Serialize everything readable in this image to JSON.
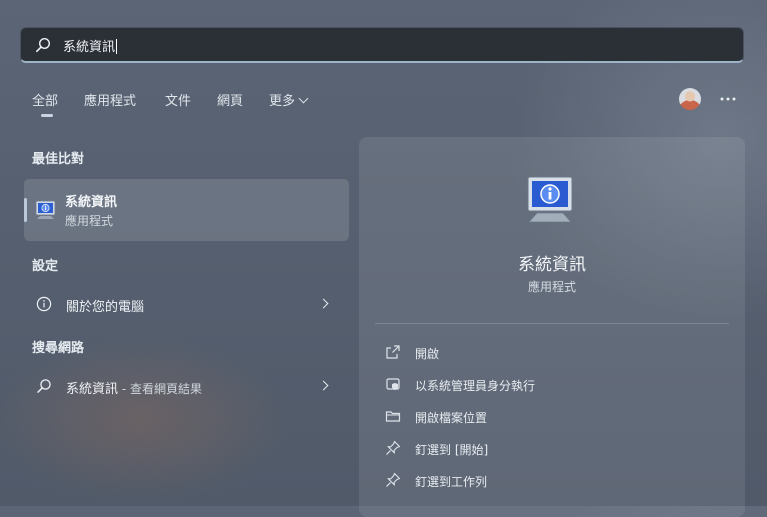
{
  "search": {
    "query": "系統資訊",
    "icon": "search-icon"
  },
  "tabs": [
    {
      "label": "全部",
      "active": true
    },
    {
      "label": "應用程式"
    },
    {
      "label": "文件"
    },
    {
      "label": "網頁"
    },
    {
      "label": "更多",
      "has_dropdown": true
    }
  ],
  "header_icons": [
    "avatar",
    "more-icon"
  ],
  "best_match": {
    "heading": "最佳比對",
    "item": {
      "title": "系統資訊",
      "subtitle": "應用程式",
      "icon": "system-info-icon"
    }
  },
  "settings": {
    "heading": "設定",
    "items": [
      {
        "label": "關於您的電腦",
        "icon": "info-icon"
      }
    ]
  },
  "web": {
    "heading": "搜尋網路",
    "items": [
      {
        "label": "系統資訊",
        "suffix": " - 查看網頁結果",
        "icon": "search-icon"
      }
    ]
  },
  "preview": {
    "title": "系統資訊",
    "subtitle": "應用程式",
    "icon": "system-info-icon",
    "actions": [
      {
        "label": "開啟",
        "icon": "open-icon"
      },
      {
        "label": "以系統管理員身分執行",
        "icon": "shield-icon"
      },
      {
        "label": "開啟檔案位置",
        "icon": "folder-icon"
      },
      {
        "label": "釘選到 [開始]",
        "icon": "pin-icon"
      },
      {
        "label": "釘選到工作列",
        "icon": "pin-icon"
      }
    ]
  },
  "colors": {
    "accent": "#9fb3c8",
    "search_bg": "#2b2f36"
  }
}
